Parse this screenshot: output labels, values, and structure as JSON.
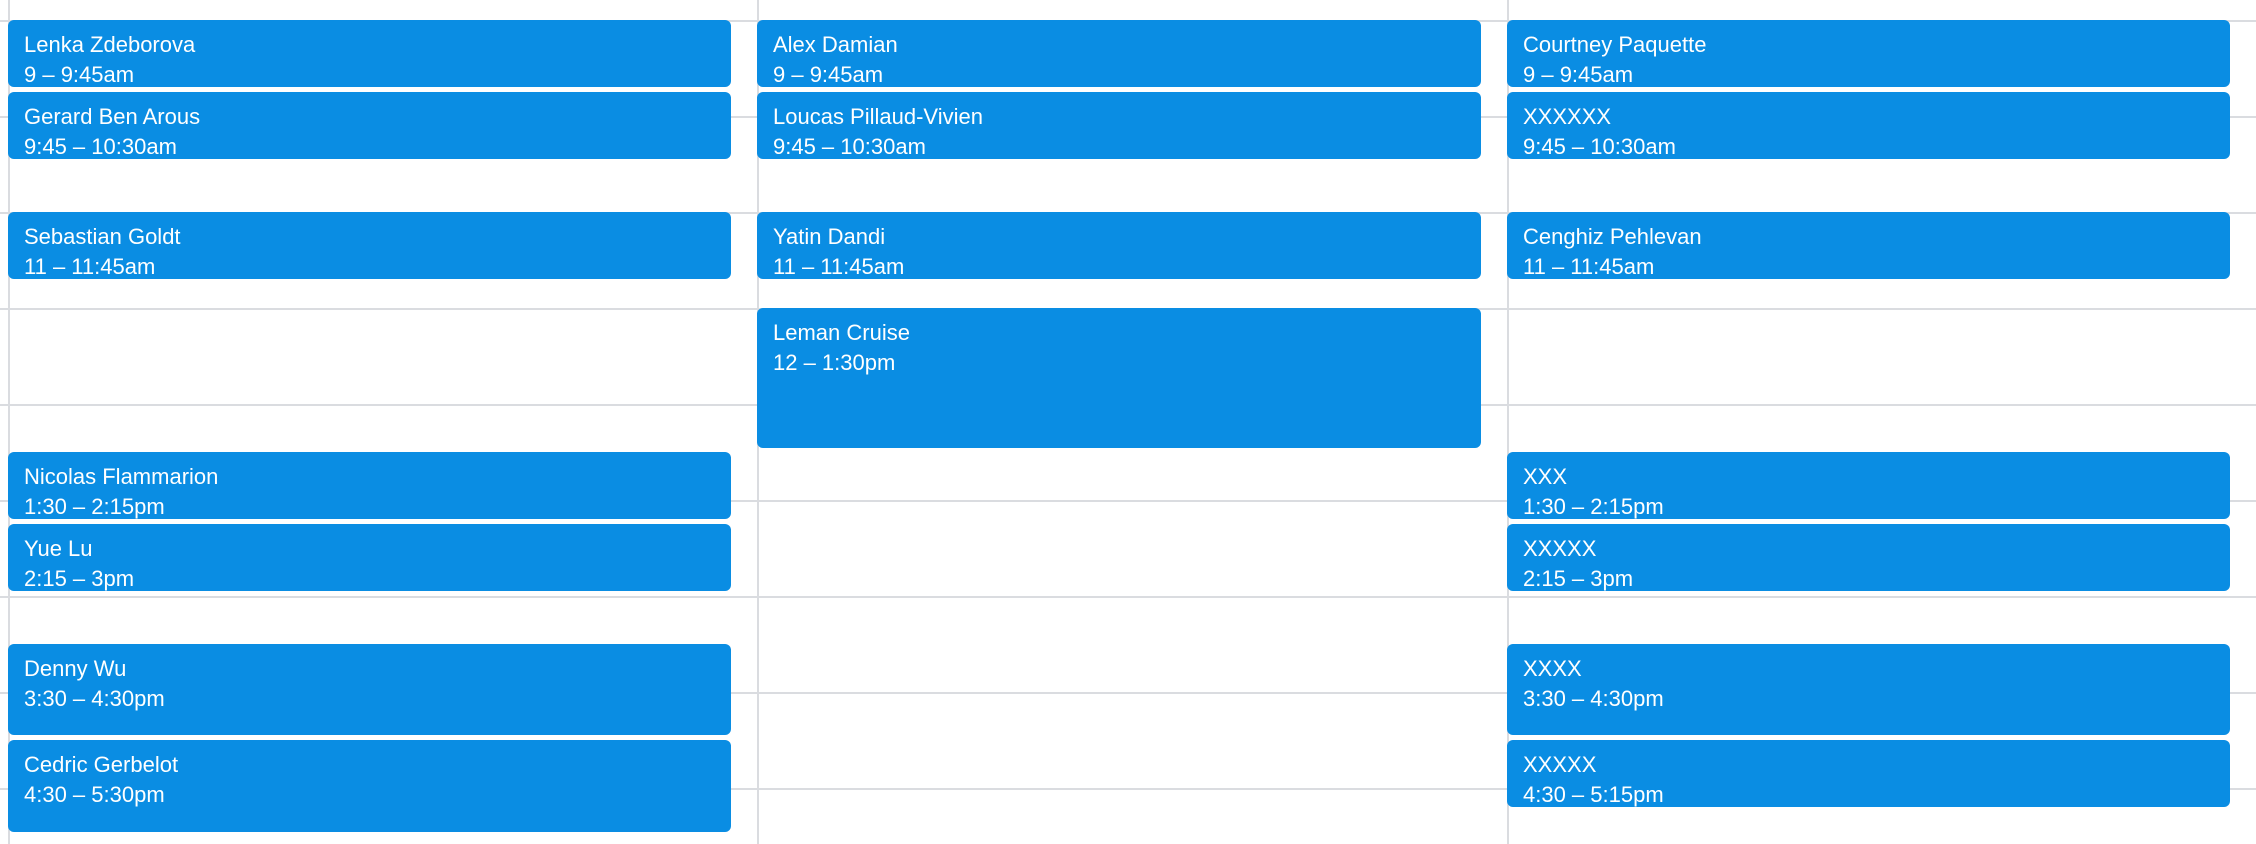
{
  "calendar": {
    "event_color": "#0a8de3",
    "grid_color": "#dadce0",
    "columns": [
      {
        "events": [
          {
            "title": "Lenka Zdeborova",
            "time": "9 – 9:45am"
          },
          {
            "title": "Gerard Ben Arous",
            "time": "9:45 – 10:30am"
          },
          {
            "title": "Sebastian Goldt",
            "time": "11 – 11:45am"
          },
          {
            "title": "Nicolas Flammarion",
            "time": "1:30 – 2:15pm"
          },
          {
            "title": "Yue Lu",
            "time": "2:15 – 3pm"
          },
          {
            "title": "Denny Wu",
            "time": "3:30 – 4:30pm"
          },
          {
            "title": "Cedric Gerbelot",
            "time": "4:30 – 5:30pm"
          }
        ]
      },
      {
        "events": [
          {
            "title": "Alex Damian",
            "time": "9 – 9:45am"
          },
          {
            "title": "Loucas Pillaud-Vivien",
            "time": "9:45 – 10:30am"
          },
          {
            "title": "Yatin Dandi",
            "time": "11 – 11:45am"
          },
          {
            "title": "Leman Cruise",
            "time": "12 – 1:30pm"
          }
        ]
      },
      {
        "events": [
          {
            "title": "Courtney Paquette",
            "time": "9 – 9:45am"
          },
          {
            "title": "XXXXXX",
            "time": "9:45 – 10:30am"
          },
          {
            "title": "Cenghiz Pehlevan",
            "time": "11 – 11:45am"
          },
          {
            "title": "XXX",
            "time": "1:30 – 2:15pm"
          },
          {
            "title": "XXXXX",
            "time": "2:15 – 3pm"
          },
          {
            "title": "XXXX",
            "time": "3:30 – 4:30pm"
          },
          {
            "title": "XXXXX",
            "time": "4:30 – 5:15pm"
          }
        ]
      }
    ]
  }
}
